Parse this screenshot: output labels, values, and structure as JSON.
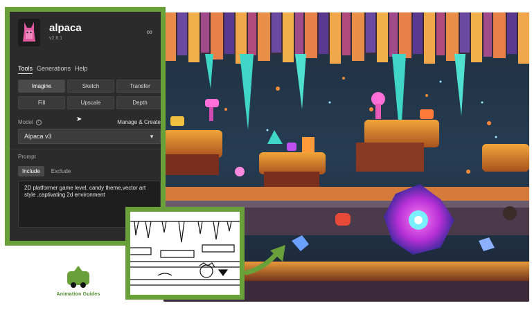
{
  "app": {
    "name": "alpaca",
    "version": "v2.8.1"
  },
  "tabs": [
    {
      "label": "Tools",
      "active": true
    },
    {
      "label": "Generations",
      "active": false
    },
    {
      "label": "Help",
      "active": false
    }
  ],
  "tools": [
    {
      "label": "Imagine",
      "active": true
    },
    {
      "label": "Sketch",
      "active": false
    },
    {
      "label": "Transfer",
      "active": false
    },
    {
      "label": "Fill",
      "active": false
    },
    {
      "label": "Upscale",
      "active": false
    },
    {
      "label": "Depth",
      "active": false
    }
  ],
  "model": {
    "label": "Model",
    "manage_label": "Manage & Create",
    "selected": "Alpaca v3"
  },
  "prompt": {
    "label": "Prompt",
    "include_label": "Include",
    "exclude_label": "Exclude",
    "text": "2D platformer game level, candy theme,vector art style ,captivating 2d environment"
  },
  "brand": {
    "name": "Animation Guides",
    "color": "#4f8a2e"
  },
  "colors": {
    "frame_green": "#6aa03a",
    "panel_bg": "#2b2b2b"
  },
  "icons": {
    "link": "infinity-link-icon",
    "info": "info-icon",
    "dropdown": "chevron-down-icon",
    "cursor": "mouse-pointer-icon"
  }
}
